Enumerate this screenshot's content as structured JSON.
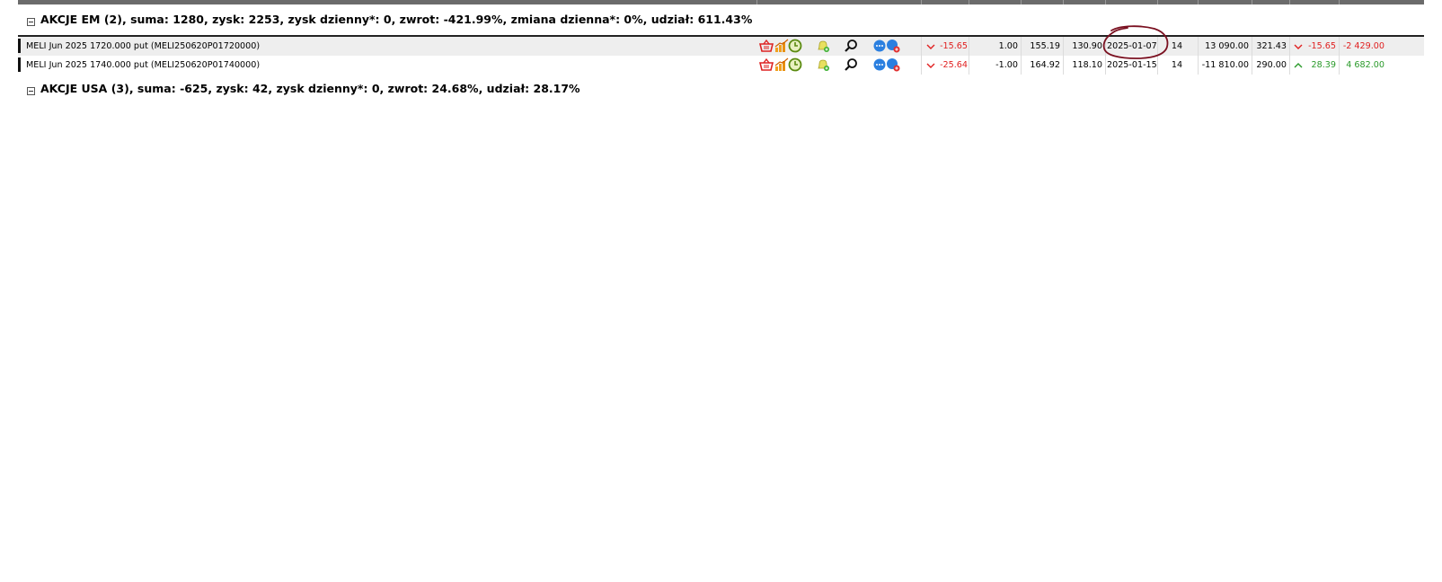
{
  "groups": [
    {
      "label": "AKCJE EM (2), suma: 1280, zysk: 2253, zysk dzienny*: 0, zwrot: -421.99%, zmiana dzienna*: 0%, udział: 611.43%"
    },
    {
      "label": "AKCJE USA (3), suma: -625, zysk: 42, zysk dzienny*: 0, zwrot: 24.68%, udział: 28.17%"
    }
  ],
  "rows": [
    {
      "name": "MELI Jun 2025 1720.000 put (MELI250620P01720000)",
      "change": "-15.65",
      "change_dir": "down",
      "qty": "1.00",
      "price1": "155.19",
      "price2": "130.90",
      "date": "2025-01-07",
      "days": "14",
      "value": "13 090.00",
      "cost": "321.43",
      "change2": "-15.65",
      "change2_dir": "down",
      "profit": "-2 429.00"
    },
    {
      "name": "MELI Jun 2025 1740.000 put (MELI250620P01740000)",
      "change": "-25.64",
      "change_dir": "down",
      "qty": "-1.00",
      "price1": "164.92",
      "price2": "118.10",
      "date": "2025-01-15",
      "days": "14",
      "value": "-11 810.00",
      "cost": "290.00",
      "change2": "28.39",
      "change2_dir": "up",
      "profit": "4 682.00"
    }
  ],
  "icons": [
    "basket-icon",
    "chart-icon",
    "clock-icon",
    "alert-bell-icon",
    "search-icon",
    "comment-icon",
    "comment-add-icon"
  ],
  "colors": {
    "negative": "#e02020",
    "positive": "#2a9a2a",
    "annotation": "#7a1020"
  }
}
